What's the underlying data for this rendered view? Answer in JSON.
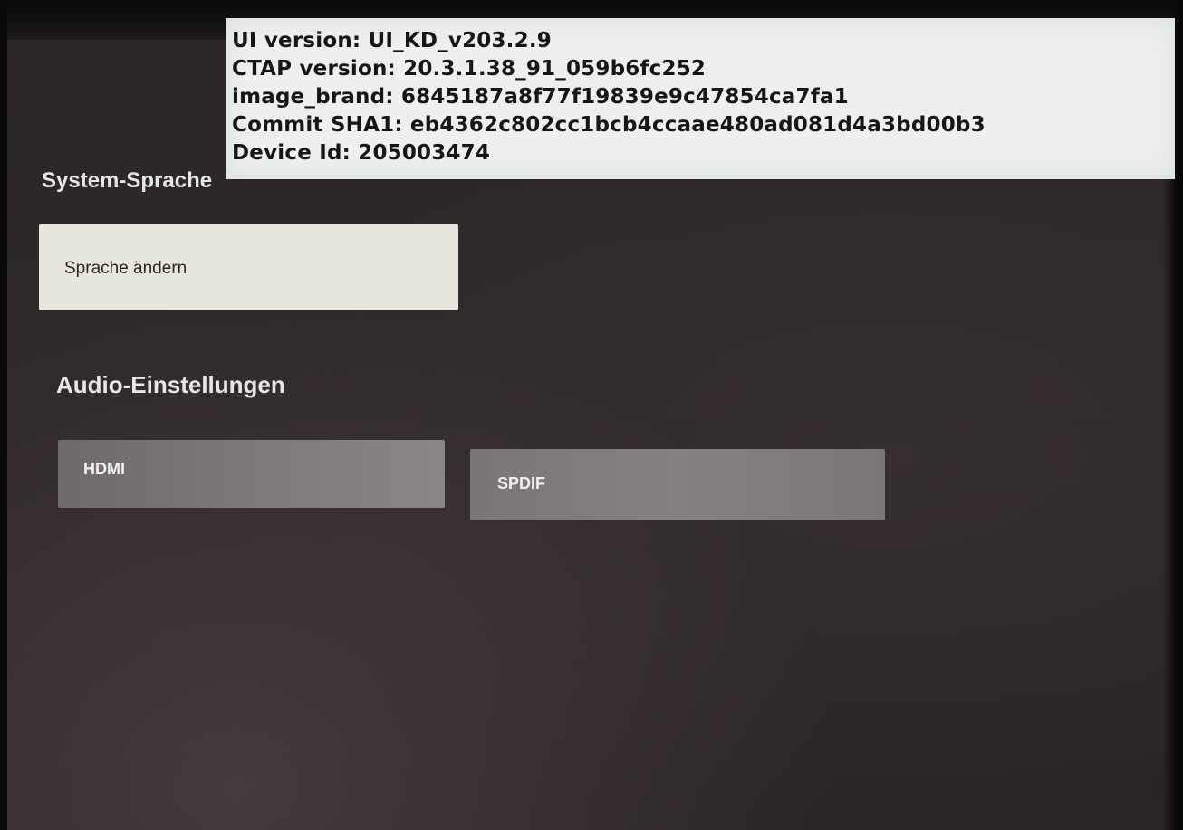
{
  "debug_overlay": {
    "lines": [
      "UI version: UI_KD_v203.2.9",
      "CTAP version: 20.3.1.38_91_059b6fc252",
      "image_brand: 6845187a8f77f19839e9c47854ca7fa1",
      "Commit SHA1: eb4362c802cc1bcb4ccaae480ad081d4a3bd00b3",
      "Device Id: 205003474"
    ]
  },
  "system_language": {
    "title": "System-Sprache",
    "change_button_label": "Sprache ändern"
  },
  "audio_settings": {
    "title": "Audio-Einstellungen",
    "options": [
      {
        "label": "HDMI"
      },
      {
        "label": "SPDIF"
      }
    ]
  },
  "colors": {
    "background": "#2c2627",
    "focused_button": "#e7e6dc",
    "unfocused_button": "#7d7979",
    "overlay_background": "#eef0ee"
  }
}
